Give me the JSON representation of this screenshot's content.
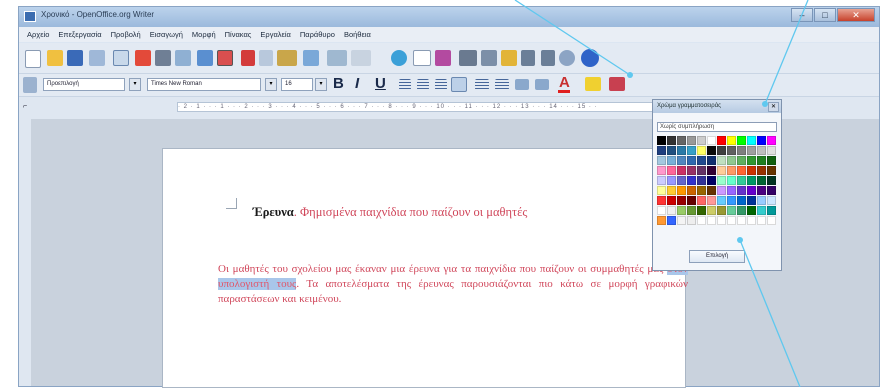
{
  "window": {
    "title": "Χρονικό - OpenOffice.org Writer",
    "controls": [
      "–",
      "□",
      "✕"
    ]
  },
  "menubar": {
    "items": [
      "Αρχείο",
      "Επεξεργασία",
      "Προβολή",
      "Εισαγωγή",
      "Μορφή",
      "Πίνακας",
      "Εργαλεία",
      "Παράθυρο",
      "Βοήθεια"
    ]
  },
  "toolbar": {
    "style_value": "Προεπιλογή",
    "font_value": "Times New Roman",
    "size_value": "16",
    "bold": "B",
    "italic": "I",
    "underline": "U",
    "font_color": "A"
  },
  "ruler": {
    "ticks": "· 2 · 1 · · · 1 · · · 2 · · · 3 · · · 4 · · · 5 · · · 6 · · · 7 · · · 8 · · · 9 · · · 10 · · · 11 · · · 12 · · · 13 · · · 14 · · · 15 · ·"
  },
  "document": {
    "title_bold": "Έρευνα",
    "title_rest": ". Φημισμένα παιχνίδια που παίζουν οι μαθητές",
    "para_start": "Οι μαθητές του σχολείου μας έκαναν μια έρευνα για τα παιχνίδια που παίζουν οι συμμαθητές μας ",
    "para_highlight": "στον υπολογιστή τους",
    "para_end": ". Τα αποτελέσματα της έρευνας παρουσιάζονται πιο κάτω σε μορφή γραφικών παραστάσεων και κειμένου."
  },
  "palette": {
    "header": "Χρώμα γραμματοσειράς",
    "selected": "Χωρίς συμπλήρωση",
    "button": "Επιλογή",
    "colors": [
      "#000000",
      "#333333",
      "#666666",
      "#999999",
      "#cccccc",
      "#ffffff",
      "#ff0000",
      "#ffff00",
      "#00ff00",
      "#00ffff",
      "#0000ff",
      "#ff00ff",
      "#1f3f7f",
      "#205080",
      "#2a7aa8",
      "#37a0c8",
      "#ffff66",
      "#0b0b0b",
      "#3f3f3f",
      "#606060",
      "#7f7f7f",
      "#9f9f9f",
      "#bfbfbf",
      "#dfdfdf",
      "#a4c8e0",
      "#78b0d8",
      "#5088c0",
      "#2f6ab0",
      "#204a90",
      "#103070",
      "#c0e0c0",
      "#90c890",
      "#60b060",
      "#309830",
      "#208020",
      "#106010",
      "#ff99cc",
      "#ff6699",
      "#cc3366",
      "#993366",
      "#663366",
      "#330033",
      "#ffcc99",
      "#ff9966",
      "#ff6633",
      "#cc3300",
      "#993300",
      "#663300",
      "#ccccff",
      "#9999ff",
      "#6666cc",
      "#3333cc",
      "#333399",
      "#000066",
      "#99ffcc",
      "#66ffcc",
      "#33cc99",
      "#009966",
      "#006633",
      "#003322",
      "#ffff99",
      "#ffcc33",
      "#ff9900",
      "#cc6600",
      "#996600",
      "#663300",
      "#cc99ff",
      "#9966ff",
      "#6633cc",
      "#6600cc",
      "#4b0082",
      "#330066",
      "#ff3333",
      "#cc0000",
      "#990000",
      "#660000",
      "#ff6666",
      "#ff9999",
      "#66ccff",
      "#3399ff",
      "#0066cc",
      "#003399",
      "#99ccff",
      "#cce6ff",
      "#ffffff",
      "#f0f0f0",
      "#99cc66",
      "#669933",
      "#336600",
      "#cccc66",
      "#999933",
      "#66cc99",
      "#339966",
      "#006600",
      "#33cccc",
      "#009999",
      "#ff9933",
      "#3366ff",
      "#f4f4f4",
      "#eeeeee",
      "#ffffff",
      "#ffffff",
      "#ffffff",
      "#ffffff",
      "#ffffff",
      "#ffffff",
      "#ffffff",
      "#ffffff"
    ]
  }
}
